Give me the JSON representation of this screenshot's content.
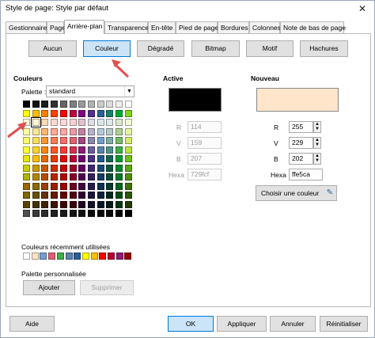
{
  "window": {
    "title": "Style de page: Style par défaut"
  },
  "tabs": [
    {
      "label": "Gestionnaire"
    },
    {
      "label": "Page"
    },
    {
      "label": "Arrière-plan"
    },
    {
      "label": "Transparence"
    },
    {
      "label": "En-tête"
    },
    {
      "label": "Pied de page"
    },
    {
      "label": "Bordures"
    },
    {
      "label": "Colonnes"
    },
    {
      "label": "Note de bas de page"
    }
  ],
  "fill_buttons": [
    {
      "label": "Aucun"
    },
    {
      "label": "Couleur"
    },
    {
      "label": "Dégradé"
    },
    {
      "label": "Bitmap"
    },
    {
      "label": "Motif"
    },
    {
      "label": "Hachures"
    }
  ],
  "colors": {
    "title": "Couleurs",
    "palette_label": "Palette :",
    "palette_value": "standard",
    "recent_title": "Couleurs récemment utilisées",
    "custom_title": "Palette personnalisée",
    "add_label": "Ajouter",
    "delete_label": "Supprimer",
    "palette_grid": [
      [
        "#000000",
        "#111111",
        "#1c1c1c",
        "#333333",
        "#666666",
        "#808080",
        "#999999",
        "#b2b2b2",
        "#cccccc",
        "#dddddd",
        "#eeeeee",
        "#ffffff"
      ],
      [
        "#ffff00",
        "#ffbf00",
        "#ff8000",
        "#ff4000",
        "#ff0000",
        "#bf0041",
        "#800080",
        "#55308d",
        "#2a6099",
        "#158466",
        "#00a933",
        "#81d41a"
      ],
      [
        "#ffffd7",
        "#fff5ce",
        "#ffdbb6",
        "#ffd8ce",
        "#ffd7d7",
        "#f7d1d5",
        "#e0c2cd",
        "#dedce6",
        "#dee6ef",
        "#dee7e5",
        "#dde8cb",
        "#f6f9d4"
      ],
      [
        "#ffffa6",
        "#ffe994",
        "#ffb66c",
        "#ffaa95",
        "#ffa6a6",
        "#ec9ba4",
        "#bf819e",
        "#b7b3ca",
        "#b4c7dc",
        "#b3cac7",
        "#afd095",
        "#e8f2a1"
      ],
      [
        "#ffff6d",
        "#ffde59",
        "#ff972f",
        "#ff7b59",
        "#ff6d6d",
        "#e16173",
        "#a1467e",
        "#8e86ae",
        "#729fcf",
        "#81aca6",
        "#77bc65",
        "#d4ea6b"
      ],
      [
        "#ffff38",
        "#ffd428",
        "#ff860d",
        "#ff5429",
        "#ff3838",
        "#d62e4e",
        "#8d1d75",
        "#6b5e9b",
        "#5983b0",
        "#50938a",
        "#3faf46",
        "#bbe33d"
      ],
      [
        "#e6e600",
        "#ffbf00",
        "#e66b00",
        "#e63a00",
        "#e60000",
        "#b80037",
        "#700070",
        "#4b2f80",
        "#1f5a8c",
        "#116653",
        "#009a2e",
        "#6ec213"
      ],
      [
        "#cccc00",
        "#cc9900",
        "#cc5900",
        "#cc3000",
        "#cc0000",
        "#a0002e",
        "#600060",
        "#3f2874",
        "#1a4a7a",
        "#0e5743",
        "#008a29",
        "#5ea80f"
      ],
      [
        "#b3b300",
        "#b38600",
        "#b34d00",
        "#b32700",
        "#b30000",
        "#870027",
        "#500050",
        "#332062",
        "#143c66",
        "#0a4a38",
        "#007824",
        "#4e8e0c"
      ],
      [
        "#996600",
        "#8c6a00",
        "#994000",
        "#992000",
        "#990000",
        "#6e0020",
        "#400040",
        "#281a4f",
        "#0f2f52",
        "#063a2c",
        "#00661e",
        "#3e7309"
      ],
      [
        "#806600",
        "#665000",
        "#663000",
        "#661a00",
        "#660000",
        "#550018",
        "#300030",
        "#1d143c",
        "#0a223d",
        "#032a20",
        "#004d16",
        "#2e5706"
      ],
      [
        "#594500",
        "#403200",
        "#402000",
        "#401100",
        "#400000",
        "#3d0011",
        "#200020",
        "#141028",
        "#061628",
        "#021c15",
        "#00330f",
        "#1f3a04"
      ],
      [
        "#4d4d4d",
        "#3a3a3a",
        "#2b2b2b",
        "#202020",
        "#1a1a1a",
        "#141414",
        "#101010",
        "#0c0c0c",
        "#080808",
        "#050505",
        "#030303",
        "#000000"
      ]
    ],
    "selected_cell": "2,1",
    "recent": [
      "#ffffff",
      "#ffe5ca",
      "#729fcf",
      "#e16173",
      "#3faf46",
      "#5983b0",
      "#2a6099",
      "#ffff00",
      "#ffbf00",
      "#ff0000",
      "#b80037",
      "#8d1d75",
      "#990000"
    ]
  },
  "active": {
    "title": "Active",
    "color": "#000000",
    "r_label": "R",
    "r": "114",
    "v_label": "V",
    "v": "159",
    "b_label": "B",
    "b": "207",
    "hex_label": "Hexa",
    "hex": "729fcf"
  },
  "nouveau": {
    "title": "Nouveau",
    "color": "#ffe5ca",
    "r_label": "R",
    "r": "255",
    "v_label": "V",
    "v": "229",
    "b_label": "B",
    "b": "202",
    "hex_label": "Hexa",
    "hex": "ffe5ca",
    "pick_label": "Choisir une couleur"
  },
  "footer": {
    "help": "Aide",
    "ok": "OK",
    "apply": "Appliquer",
    "cancel": "Annuler",
    "reset": "Réinitialiser"
  },
  "accent": "#0078d7",
  "annotation_arrow_color": "#e0504e"
}
